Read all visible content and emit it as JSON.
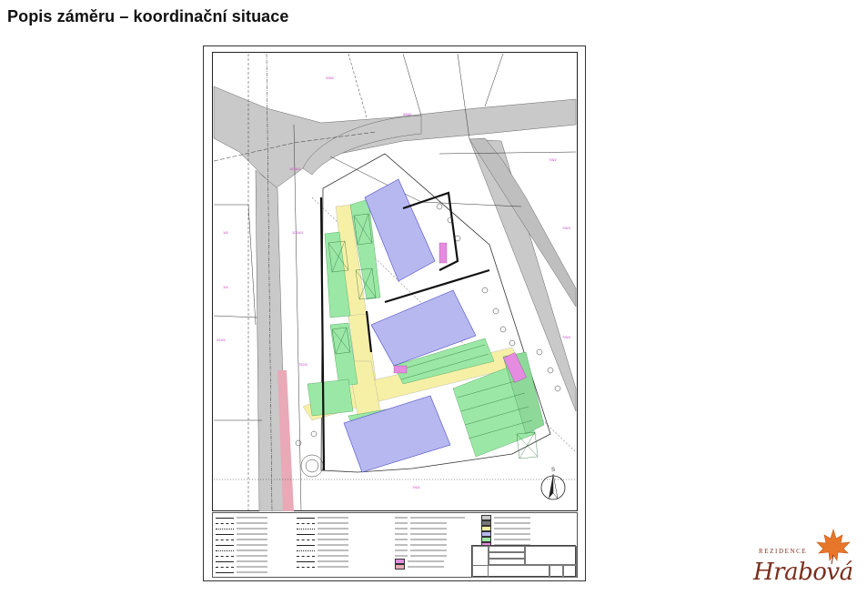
{
  "page": {
    "title": "Popis záměru – koordinační situace"
  },
  "plan": {
    "north_label": "S"
  },
  "logo": {
    "line1": "REZIDENCE",
    "line2": "Hrabová"
  },
  "colors": {
    "building": "#b7b8f0",
    "green": "#9be8a6",
    "path": "#f6f0a6",
    "road": "#c9c9c9",
    "accent_pink": "#e58be0",
    "rail_pink": "#e9a9b7",
    "logo_brown": "#7a2e1e",
    "leaf_orange": "#e8762a"
  }
}
